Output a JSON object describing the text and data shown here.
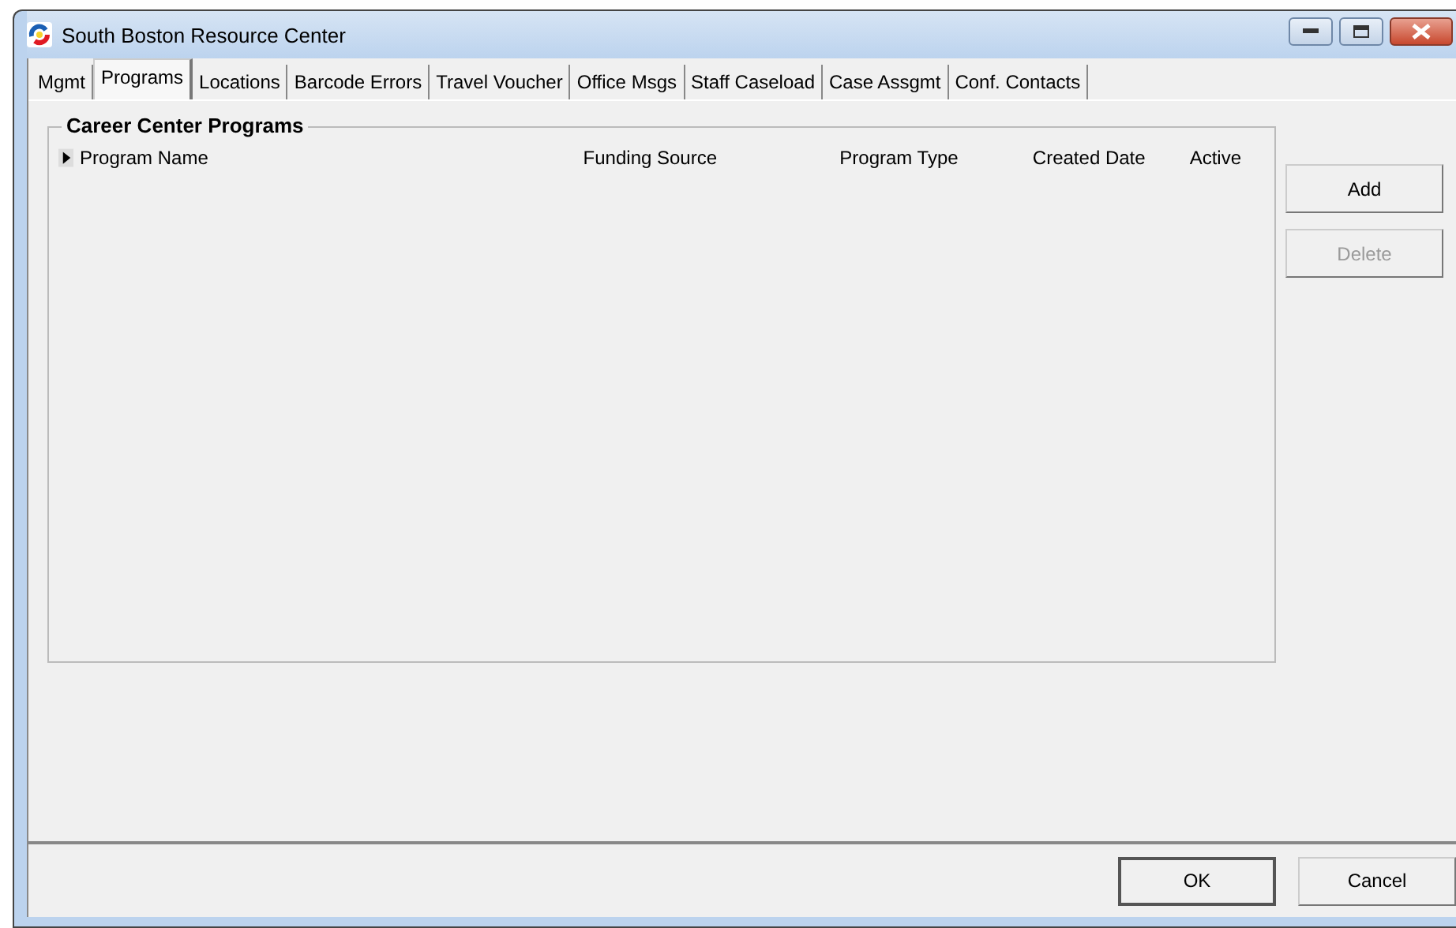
{
  "window": {
    "title": "South Boston Resource Center"
  },
  "tabs": [
    {
      "label": "Mgmt",
      "selected": false
    },
    {
      "label": "Programs",
      "selected": true
    },
    {
      "label": "Locations",
      "selected": false
    },
    {
      "label": "Barcode Errors",
      "selected": false
    },
    {
      "label": "Travel Voucher",
      "selected": false
    },
    {
      "label": "Office Msgs",
      "selected": false
    },
    {
      "label": "Staff Caseload",
      "selected": false
    },
    {
      "label": "Case Assgmt",
      "selected": false
    },
    {
      "label": "Conf. Contacts",
      "selected": false
    }
  ],
  "group": {
    "title": "Career Center Programs",
    "table": {
      "columns": [
        "Program Name",
        "Funding Source",
        "Program Type",
        "Created Date",
        "Active"
      ]
    }
  },
  "side_buttons": [
    {
      "label": "Add",
      "disabled": false
    },
    {
      "label": "Delete",
      "disabled": true
    }
  ],
  "footer_buttons": [
    "OK",
    "Cancel"
  ]
}
